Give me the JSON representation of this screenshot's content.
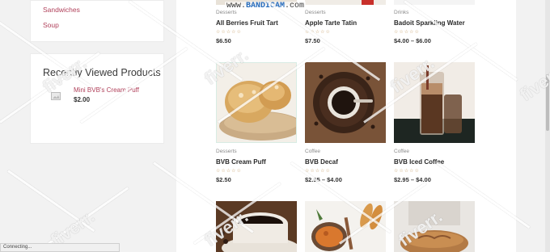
{
  "sidebar": {
    "categories": [
      "Sandwiches",
      "Soup"
    ],
    "recent": {
      "title": "Recently Viewed Products",
      "items": [
        {
          "name": "Mini BVB's Cream Puff",
          "price": "$2.00"
        }
      ]
    }
  },
  "recording": {
    "label_prefix": "www.",
    "brand": "BANDICAM",
    "suffix": ".com"
  },
  "products_top": [
    {
      "category": "Desserts",
      "name": "All Berries Fruit Tart",
      "price": "$6.50"
    },
    {
      "category": "Desserts",
      "name": "Apple Tarte Tatin",
      "price": "$7.50"
    },
    {
      "category": "Drinks",
      "name": "Badoit Sparkling Water",
      "price": "$4.00 – $6.00"
    }
  ],
  "products_mid": [
    {
      "category": "Desserts",
      "name": "BVB Cream Puff",
      "price": "$2.50",
      "image": "cream-puff"
    },
    {
      "category": "Coffee",
      "name": "BVB Decaf",
      "price": "$2.95 – $4.00",
      "image": "decaf"
    },
    {
      "category": "Coffee",
      "name": "BVB Iced Coffee",
      "price": "$2.95 – $4.00",
      "image": "iced-coffee"
    }
  ],
  "products_bottom": [
    {
      "image": "espresso"
    },
    {
      "image": "soup"
    },
    {
      "image": "bread"
    }
  ],
  "stars": "☆☆☆☆☆",
  "status_bar": "Connecting...",
  "watermark": "fiverr."
}
